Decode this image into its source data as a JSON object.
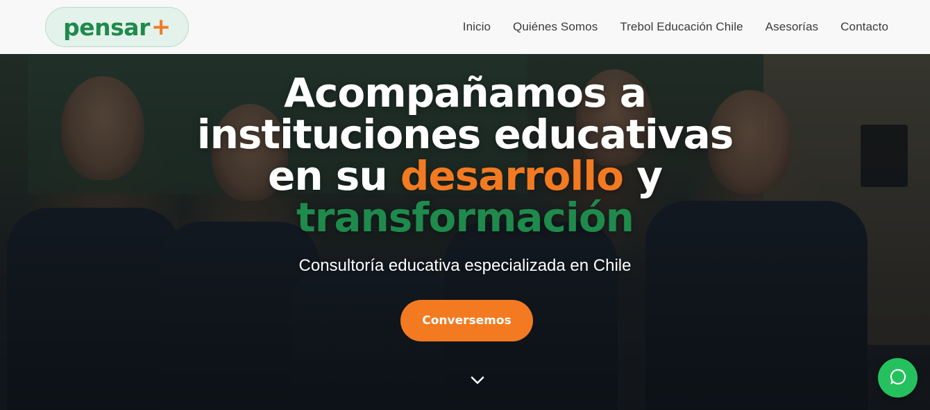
{
  "logo": {
    "word": "pensar",
    "plus": "+"
  },
  "nav": {
    "items": [
      {
        "label": "Inicio"
      },
      {
        "label": "Quiénes Somos"
      },
      {
        "label": "Trebol Educación Chile"
      },
      {
        "label": "Asesorías"
      },
      {
        "label": "Contacto"
      }
    ]
  },
  "hero": {
    "line1": "Acompañamos a",
    "line2": "instituciones educativas",
    "line3_start": "en su ",
    "line3_accent": "desarrollo",
    "line3_end": " y",
    "line4_accent": "transformación",
    "subtitle": "Consultoría educativa especializada en Chile",
    "cta_label": "Conversemos"
  },
  "icons": {
    "scroll": "chevron-down-icon",
    "chat": "whatsapp-icon"
  },
  "colors": {
    "brand_green": "#1e8a4c",
    "brand_orange": "#f37a21",
    "chat_green": "#25c15e"
  }
}
